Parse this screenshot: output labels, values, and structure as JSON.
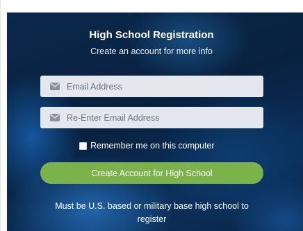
{
  "form": {
    "title": "High School Registration",
    "subtitle": "Create an account for more info",
    "email_placeholder": "Email Address",
    "email_value": "",
    "reenter_placeholder": "Re-Enter Email Address",
    "reenter_value": "",
    "remember_label": "Remember me on this computer",
    "remember_checked": false,
    "submit_label": "Create Account for High School",
    "note_line1": "Must be U.S. based or military base high school to",
    "note_line2": "register"
  },
  "icons": {
    "email": "envelope-icon"
  },
  "colors": {
    "primary_button": "#7bb34a",
    "background": "#0a2647",
    "field": "#e4e8ee",
    "text": "#ffffff"
  }
}
